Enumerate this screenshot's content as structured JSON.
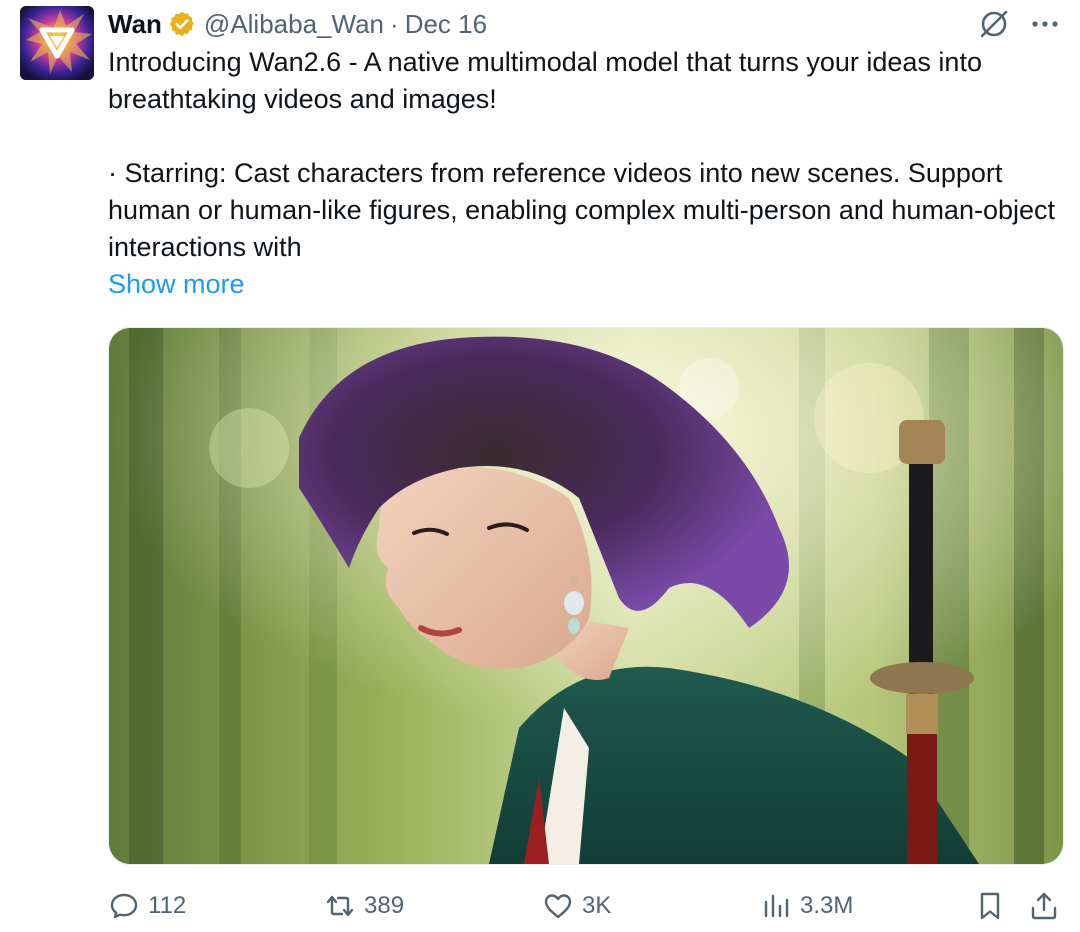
{
  "author": {
    "name": "Wan",
    "verified": true,
    "handle": "@Alibaba_Wan",
    "separator": "·",
    "date": "Dec 16",
    "avatar_icon": "wan-logo-avatar"
  },
  "header_icons": [
    "grok-icon",
    "more-options-icon"
  ],
  "tweet": {
    "text": "Introducing Wan2.6 - A native multimodal model that turns your ideas into breathtaking videos and images!\n\n· Starring: Cast characters from reference videos into new scenes. Support human or human-like figures, enabling complex multi-person and human-object interactions with",
    "show_more": "Show more"
  },
  "media": {
    "description_icon": "video-still-woman-with-sword-in-bamboo-forest"
  },
  "actions": {
    "replies": "112",
    "reposts": "389",
    "likes": "3K",
    "views": "3.3M"
  },
  "colors": {
    "text": "#0f1419",
    "secondary": "#536471",
    "link": "#1d9bf0",
    "verified_gold": "#e8b21a"
  }
}
